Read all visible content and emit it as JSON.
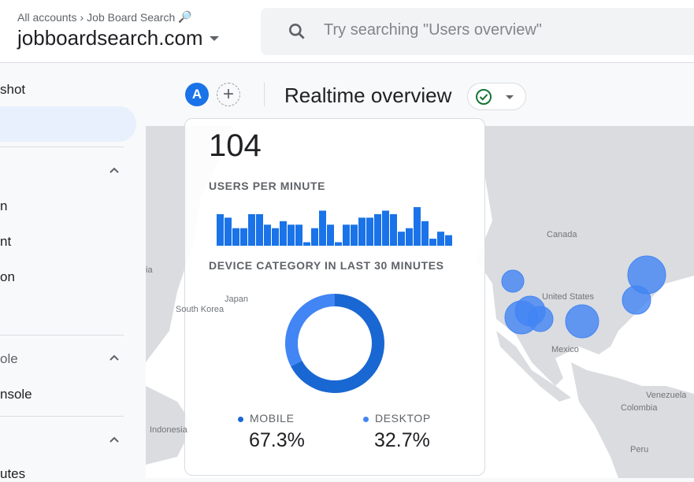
{
  "header": {
    "breadcrumb": [
      "All accounts",
      "Job Board Search"
    ],
    "property": "jobboardsearch.com",
    "search_placeholder": "Try searching \"Users overview\""
  },
  "sidebar": {
    "items": [
      "shot",
      "n",
      "nt",
      "on",
      "ole",
      "nsole",
      "utes"
    ]
  },
  "topbar": {
    "avatar": "A",
    "add": "+",
    "title": "Realtime overview"
  },
  "card": {
    "users_total": "104",
    "users_per_minute_label": "USERS PER MINUTE",
    "device_label": "DEVICE CATEGORY IN LAST 30 MINUTES",
    "legend": [
      {
        "name": "MOBILE",
        "value": "67.3%",
        "pct": 67.3,
        "color": "#1967d2"
      },
      {
        "name": "DESKTOP",
        "value": "32.7%",
        "pct": 32.7,
        "color": "#4285f4"
      }
    ]
  },
  "chart_data": {
    "type": "bar",
    "title": "USERS PER MINUTE",
    "values": [
      9,
      8,
      5,
      5,
      9,
      9,
      6,
      5,
      7,
      6,
      6,
      1,
      5,
      10,
      6,
      1,
      6,
      6,
      8,
      8,
      9,
      10,
      9,
      4,
      5,
      11,
      7,
      2,
      4,
      3
    ]
  },
  "map": {
    "labels": [
      "Canada",
      "United States",
      "Mexico",
      "Venezuela",
      "Colombia",
      "Peru",
      "Japan",
      "South Korea",
      "Indonesia",
      "ia"
    ],
    "bubble_color": "#4285f4"
  }
}
